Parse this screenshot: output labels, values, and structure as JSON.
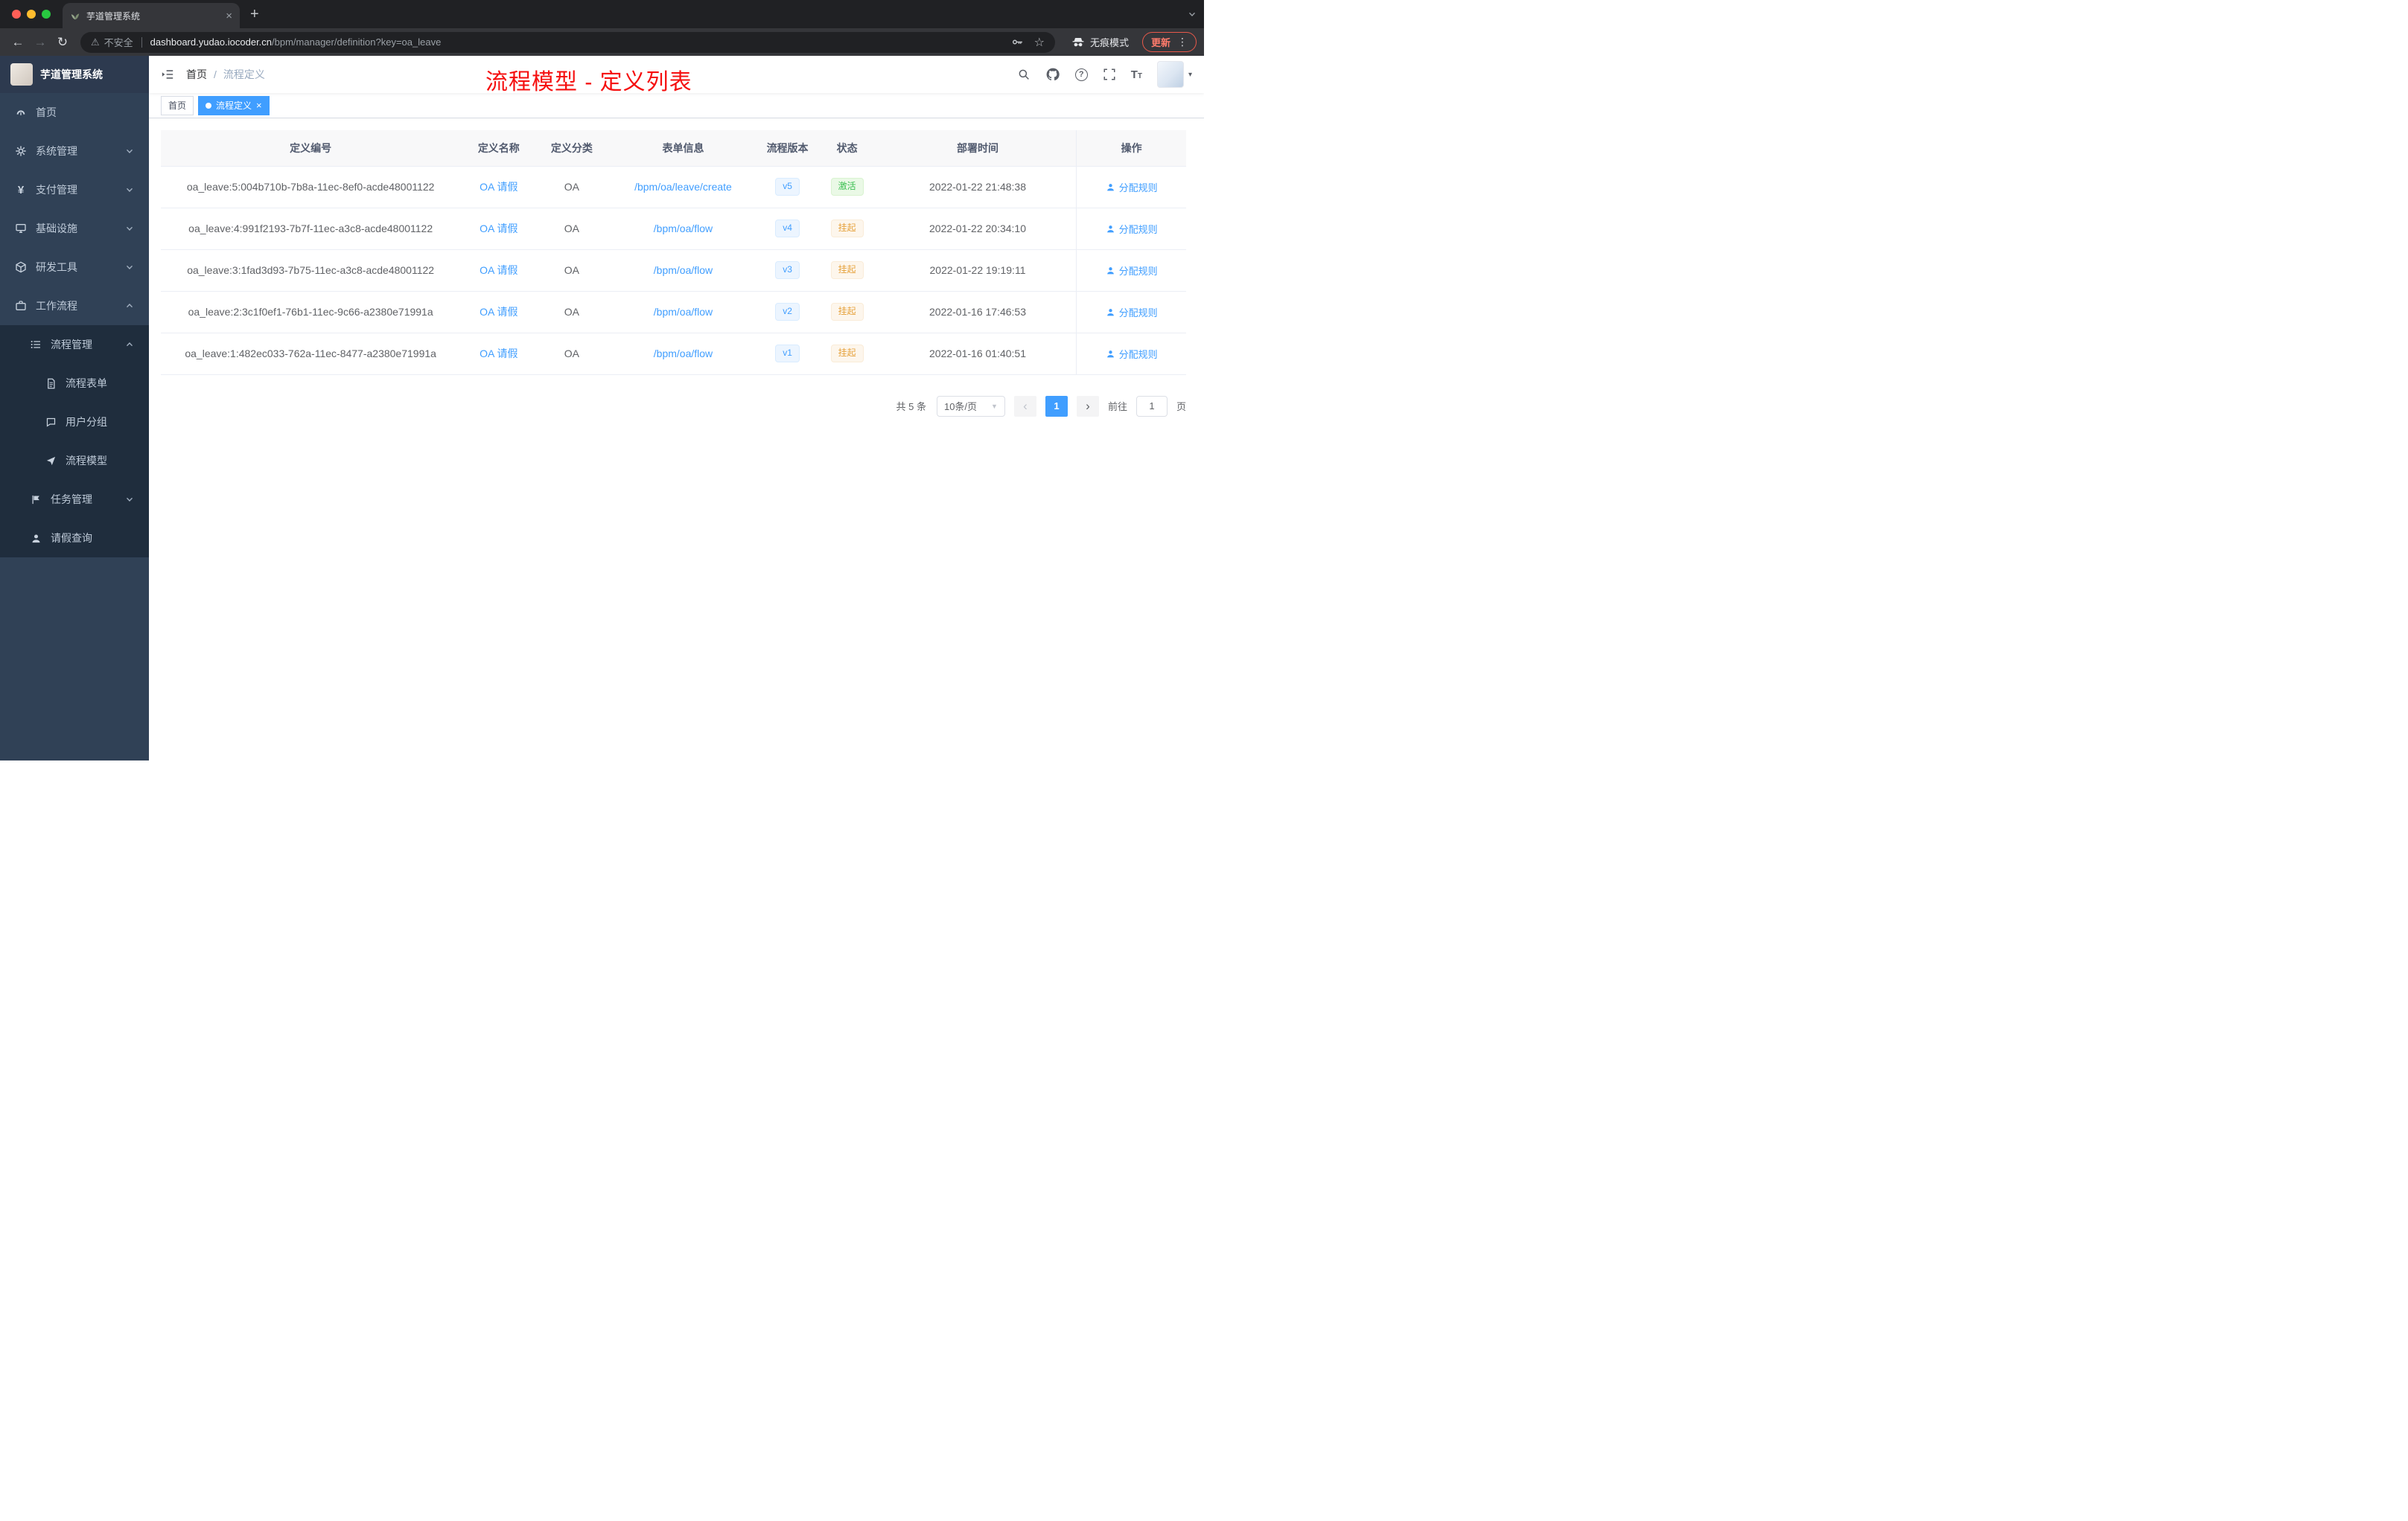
{
  "browser": {
    "tab_title": "芋道管理系统",
    "security_label": "不安全",
    "url_domain": "dashboard.yudao.iocoder.cn",
    "url_path": "/bpm/manager/definition?key=oa_leave",
    "incognito_label": "无痕模式",
    "update_label": "更新"
  },
  "icons": {
    "close": "×",
    "plus": "+",
    "back": "←",
    "forward": "→",
    "reload": "↻",
    "warning": "⚠",
    "star": "☆",
    "kebab": "⋮",
    "question": "?",
    "caret_down": "▾",
    "prev": "‹",
    "next": "›",
    "select_caret": "▼",
    "breadcrumb_separator": "/"
  },
  "sidebar": {
    "logo_title": "芋道管理系统",
    "items": [
      {
        "label": "首页"
      },
      {
        "label": "系统管理"
      },
      {
        "label": "支付管理"
      },
      {
        "label": "基础设施"
      },
      {
        "label": "研发工具"
      },
      {
        "label": "工作流程"
      },
      {
        "label": "流程管理"
      },
      {
        "label": "流程表单"
      },
      {
        "label": "用户分组"
      },
      {
        "label": "流程模型"
      },
      {
        "label": "任务管理"
      },
      {
        "label": "请假查询"
      }
    ]
  },
  "header": {
    "breadcrumb_home": "首页",
    "breadcrumb_current": "流程定义",
    "annotation": "流程模型 - 定义列表"
  },
  "tags": {
    "home": "首页",
    "active": "流程定义"
  },
  "table": {
    "columns": [
      "定义编号",
      "定义名称",
      "定义分类",
      "表单信息",
      "流程版本",
      "状态",
      "部署时间",
      "操作"
    ],
    "action_label": "分配规则",
    "rows": [
      {
        "id": "oa_leave:5:004b710b-7b8a-11ec-8ef0-acde48001122",
        "name": "OA 请假",
        "category": "OA",
        "form": "/bpm/oa/leave/create",
        "version": "v5",
        "status": "激活",
        "time": "2022-01-22 21:48:38"
      },
      {
        "id": "oa_leave:4:991f2193-7b7f-11ec-a3c8-acde48001122",
        "name": "OA 请假",
        "category": "OA",
        "form": "/bpm/oa/flow",
        "version": "v4",
        "status": "挂起",
        "time": "2022-01-22 20:34:10"
      },
      {
        "id": "oa_leave:3:1fad3d93-7b75-11ec-a3c8-acde48001122",
        "name": "OA 请假",
        "category": "OA",
        "form": "/bpm/oa/flow",
        "version": "v3",
        "status": "挂起",
        "time": "2022-01-22 19:19:11"
      },
      {
        "id": "oa_leave:2:3c1f0ef1-76b1-11ec-9c66-a2380e71991a",
        "name": "OA 请假",
        "category": "OA",
        "form": "/bpm/oa/flow",
        "version": "v2",
        "status": "挂起",
        "time": "2022-01-16 17:46:53"
      },
      {
        "id": "oa_leave:1:482ec033-762a-11ec-8477-a2380e71991a",
        "name": "OA 请假",
        "category": "OA",
        "form": "/bpm/oa/flow",
        "version": "v1",
        "status": "挂起",
        "time": "2022-01-16 01:40:51"
      }
    ]
  },
  "pagination": {
    "total": "共 5 条",
    "page_size": "10条/页",
    "current": "1",
    "goto_label": "前往",
    "goto_value": "1",
    "page_unit": "页"
  },
  "colors": {
    "accent": "#409eff",
    "annotation_red": "#f50f0f",
    "status_active_green": "#3cc051",
    "status_suspended_orange": "#e6a23c",
    "sidebar_bg": "#304156",
    "submenu_bg": "#1f2d3d",
    "browser_dark": "#202124"
  }
}
